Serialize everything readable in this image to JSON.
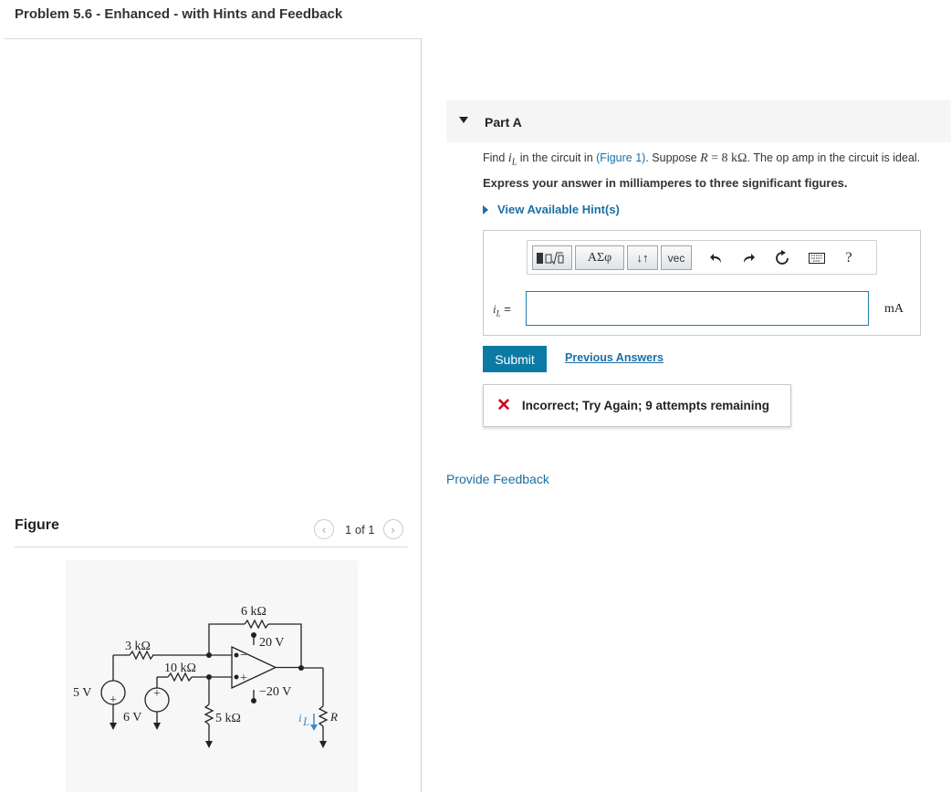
{
  "problem_title": "Problem 5.6 - Enhanced - with Hints and Feedback",
  "figure": {
    "label": "Figure",
    "page_indicator": "1 of 1",
    "prev_icon": "chevron-left-icon",
    "next_icon": "chevron-right-icon",
    "circuit_labels": {
      "r_top": "6 kΩ",
      "r_3k": "3 kΩ",
      "r_10k": "10 kΩ",
      "r_5k": "5 kΩ",
      "supply_pos": "20 V",
      "supply_neg": "−20 V",
      "src_5v": "5 V",
      "src_6v": "6 V",
      "load_current": "i",
      "load_current_sub": "L",
      "load_r": "R"
    }
  },
  "part": {
    "label": "Part A",
    "question_pre": "Find",
    "question_var": "i",
    "question_var_sub": "L",
    "question_mid": "in the circuit in",
    "figure_link": "(Figure 1)",
    "question_suppose": ". Suppose",
    "r_var": "R",
    "r_value": "= 8 kΩ",
    "question_post": ". The op amp in the circuit is ideal.",
    "instruction": "Express your answer in milliamperes to three significant figures.",
    "hint_toggle": "View Available Hint(s)"
  },
  "toolbar": {
    "templates_icon": "templates-icon",
    "greek_label": "ΑΣφ",
    "arrows_label": "↓↑",
    "vec_label": "vec",
    "undo_icon": "undo-icon",
    "redo_icon": "redo-icon",
    "reset_icon": "reset-icon",
    "keyboard_icon": "keyboard-icon",
    "help_label": "?"
  },
  "answer": {
    "label_var": "i",
    "label_sub": "L",
    "label_eq": "=",
    "value": "",
    "unit": "mA"
  },
  "submit_label": "Submit",
  "previous_answers_label": "Previous Answers",
  "feedback": {
    "status": "Incorrect; Try Again; 9 attempts remaining"
  },
  "provide_feedback_label": "Provide Feedback",
  "colors": {
    "link": "#1c6ea4",
    "submit": "#0c7aa4",
    "error": "#d0021b",
    "input_border": "#1c7fa8"
  }
}
